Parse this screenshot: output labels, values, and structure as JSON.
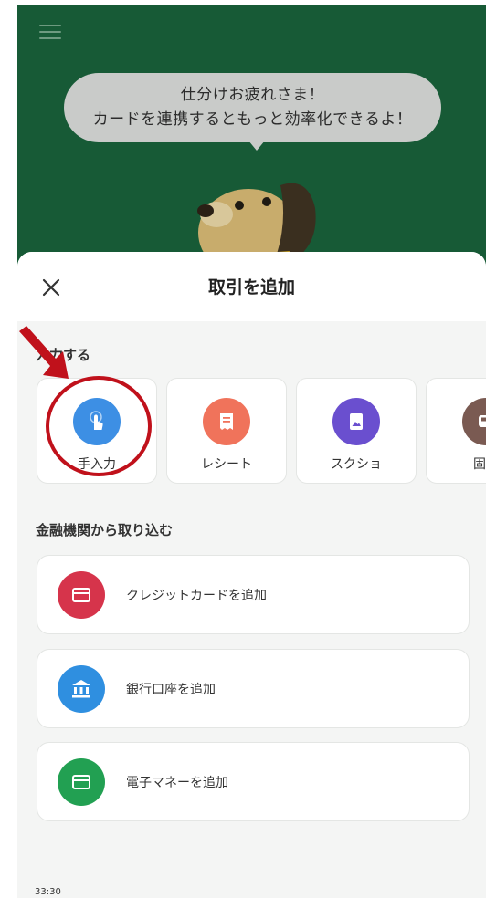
{
  "bubble": {
    "line1": "仕分けお疲れさま！",
    "line2": "カードを連携するともっと効率化できるよ！"
  },
  "sheet": {
    "title": "取引を追加",
    "input_section_label": "入力する",
    "input_options": [
      {
        "label": "手入力",
        "icon": "touch-icon",
        "color": "#3d8fe4"
      },
      {
        "label": "レシート",
        "icon": "receipt-icon",
        "color": "#f0735b"
      },
      {
        "label": "スクショ",
        "icon": "screenshot-icon",
        "color": "#6a4fcf"
      },
      {
        "label": "固定",
        "icon": "car-icon",
        "color": "#7a5a52"
      }
    ],
    "bank_section_label": "金融機関から取り込む",
    "bank_options": [
      {
        "label": "クレジットカードを追加",
        "icon": "credit-card-icon",
        "color": "#d6344b"
      },
      {
        "label": "銀行口座を追加",
        "icon": "bank-icon",
        "color": "#2f8fe0"
      },
      {
        "label": "電子マネーを追加",
        "icon": "e-money-card-icon",
        "color": "#22a052"
      }
    ]
  },
  "timestamp": "33:30",
  "colors": {
    "header_green": "#175a36",
    "annotation_red": "#c0111b"
  }
}
